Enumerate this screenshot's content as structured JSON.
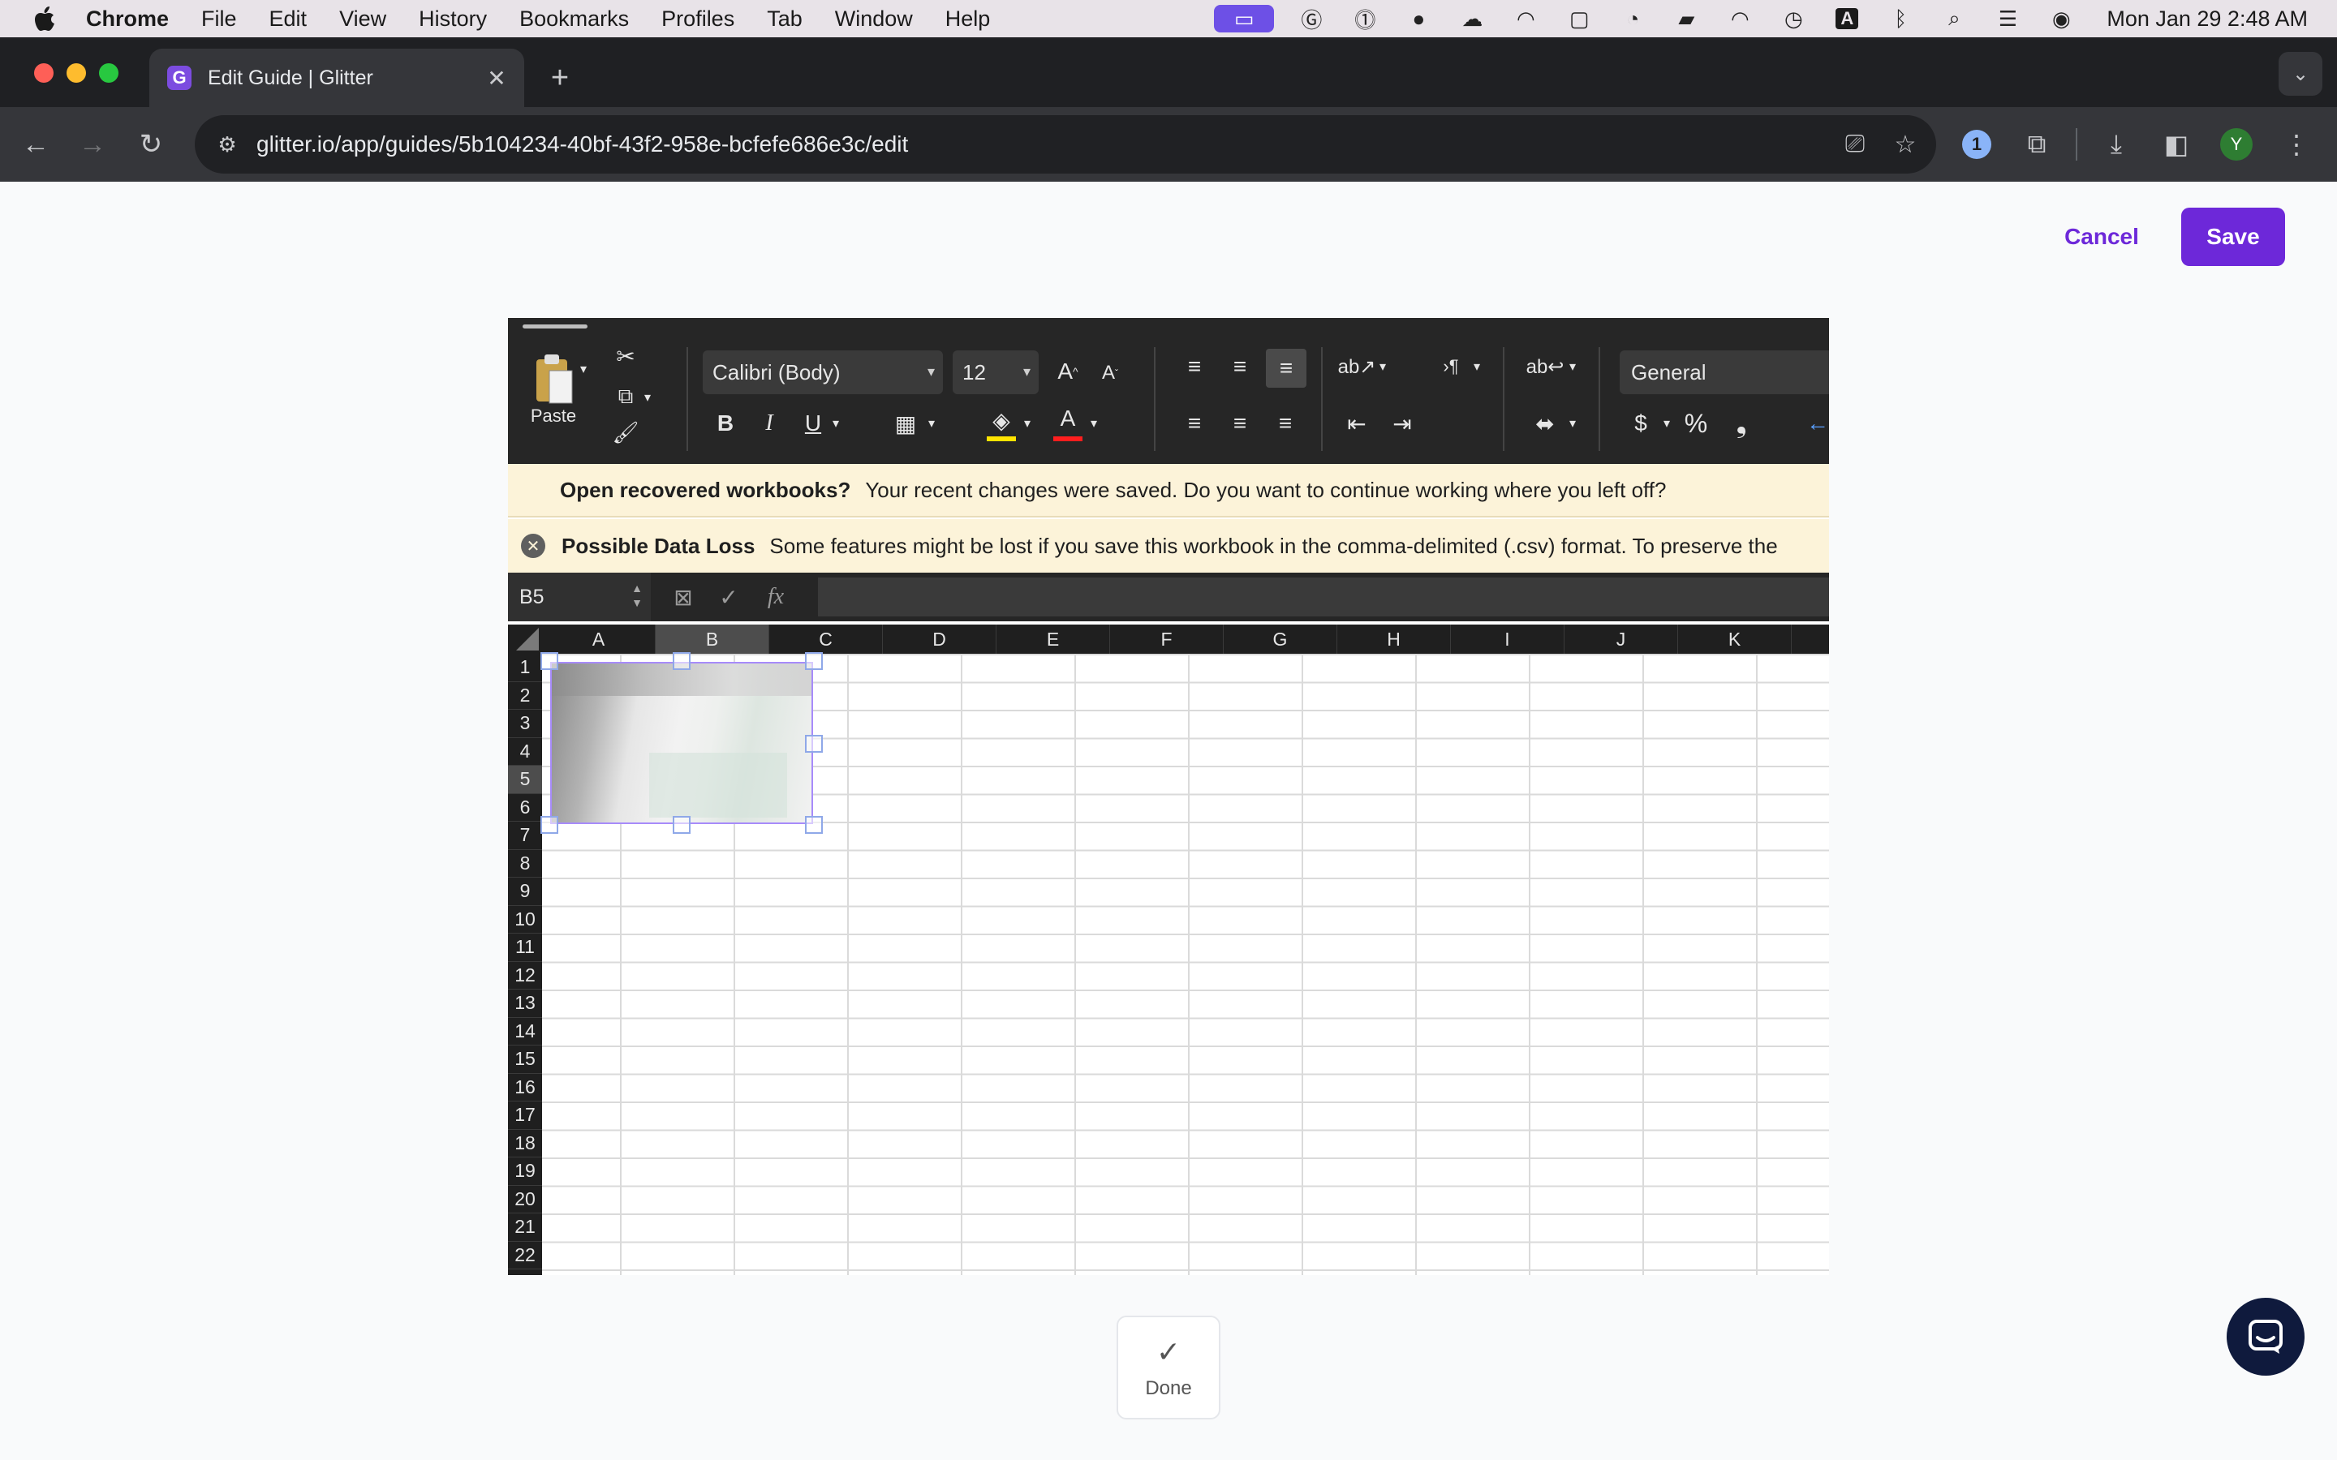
{
  "menubar": {
    "app": "Chrome",
    "items": [
      "File",
      "Edit",
      "View",
      "History",
      "Bookmarks",
      "Profiles",
      "Tab",
      "Window",
      "Help"
    ],
    "clock": "Mon Jan 29  2:48 AM",
    "status_icons": [
      "screen-share-icon",
      "grammarly-icon",
      "password-manager-icon",
      "circle-app-icon",
      "weather-icon",
      "arc-icon",
      "app-square-icon",
      "moon-face-icon",
      "battery-icon",
      "wifi-icon",
      "time-machine-icon",
      "input-source-icon",
      "bluetooth-icon",
      "spotlight-icon",
      "control-center-icon",
      "siri-icon"
    ],
    "input_source": "A"
  },
  "browser": {
    "tab_title": "Edit Guide | Glitter",
    "tab_favicon": "G",
    "url": "glitter.io/app/guides/5b104234-40bf-43f2-958e-bcfefe686e3c/edit",
    "profile_initial": "Y"
  },
  "page": {
    "cancel_label": "Cancel",
    "save_label": "Save",
    "done_label": "Done",
    "accent_color": "#6d28d9"
  },
  "excel": {
    "paste_label": "Paste",
    "font_name": "Calibri (Body)",
    "font_size": "12",
    "number_format": "General",
    "recovered_title": "Open recovered workbooks?",
    "recovered_text": "Your recent changes were saved. Do you want to continue working where you left off?",
    "dataloss_title": "Possible Data Loss",
    "dataloss_text": "Some features might be lost if you save this workbook in the comma-delimited (.csv) format. To preserve the",
    "name_box": "B5",
    "fx_label": "fx",
    "columns": [
      "A",
      "B",
      "C",
      "D",
      "E",
      "F",
      "G",
      "H",
      "I",
      "J",
      "K"
    ],
    "selected_column": "B",
    "rows": [
      "1",
      "2",
      "3",
      "4",
      "5",
      "6",
      "7",
      "8",
      "9",
      "10",
      "11",
      "12",
      "13",
      "14",
      "15",
      "16",
      "17",
      "18",
      "19",
      "20",
      "21",
      "22"
    ],
    "selected_row": "5"
  }
}
